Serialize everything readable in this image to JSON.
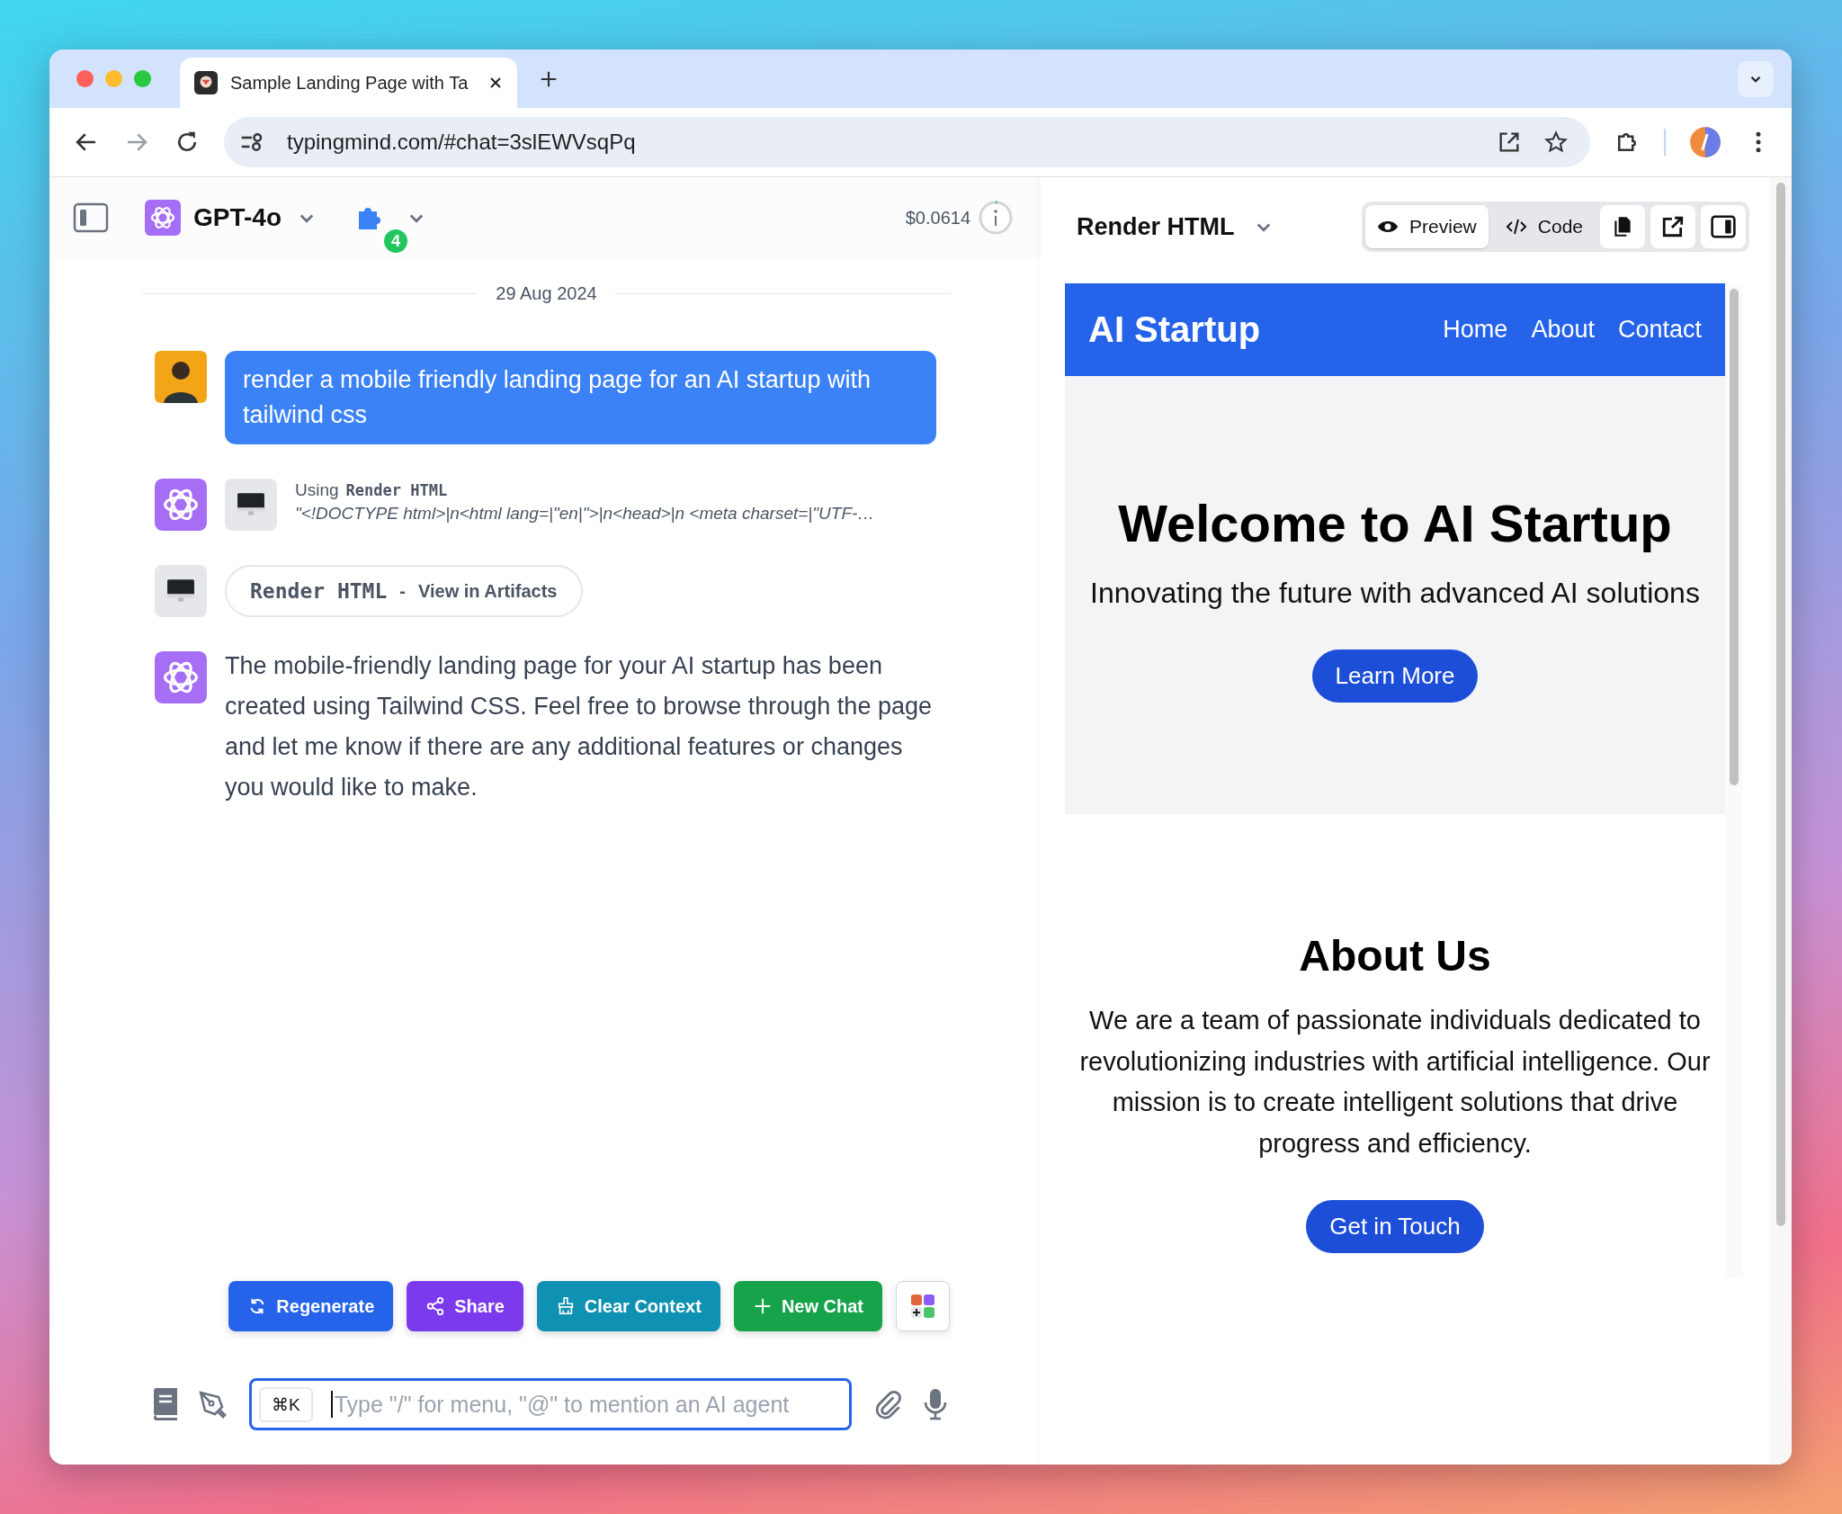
{
  "browser": {
    "tabs": [
      {
        "title": "Sample Landing Page with Ta",
        "selected": true
      }
    ],
    "url": "typingmind.com/#chat=3slEWVsqPq"
  },
  "chat": {
    "model": "GPT-4o",
    "plugin_count": "4",
    "cost": "$0.0614",
    "date": "29 Aug 2024",
    "messages": [
      {
        "kind": "user",
        "text": "render a mobile friendly landing page for an AI startup with tailwind css"
      },
      {
        "kind": "tool",
        "label": "Using",
        "tool": "Render HTML",
        "detail": "\"<!DOCTYPE html>|n<html lang=|\"en|\">|n<head>|n <meta charset=|\"UTF-…"
      },
      {
        "kind": "artifact",
        "tool": "Render HTML",
        "separator": "-",
        "link": "View in Artifacts"
      },
      {
        "kind": "assistant",
        "text": "The mobile-friendly landing page for your AI startup has been created using Tailwind CSS. Feel free to browse through the page and let me know if there are any additional features or changes you would like to make."
      }
    ],
    "actions": [
      {
        "kind": "regenerate",
        "label": "Regenerate",
        "color": "#2563eb"
      },
      {
        "kind": "share",
        "label": "Share",
        "color": "#7c3aed"
      },
      {
        "kind": "clear",
        "label": "Clear Context",
        "color": "#0e91b2"
      },
      {
        "kind": "new",
        "label": "New Chat",
        "color": "#16a34a"
      }
    ],
    "input": {
      "shortcut": "⌘K",
      "placeholder": "Type \"/\" for menu, \"@\" to mention an AI agent"
    }
  },
  "artifact": {
    "title": "Render HTML",
    "views": [
      {
        "label": "Preview",
        "selected": true,
        "kind": "eye"
      },
      {
        "label": "Code",
        "selected": false,
        "kind": "code"
      }
    ],
    "preview": {
      "brand": "AI Startup",
      "nav": [
        "Home",
        "About",
        "Contact"
      ],
      "hero_title": "Welcome to AI Startup",
      "hero_subtitle": "Innovating the future with advanced AI solutions",
      "hero_button": "Learn More",
      "about_title": "About Us",
      "about_text": "We are a team of passionate individuals dedicated to revolutionizing industries with artificial intelligence. Our mission is to create intelligent solutions that drive progress and efficiency.",
      "about_button": "Get in Touch"
    }
  }
}
